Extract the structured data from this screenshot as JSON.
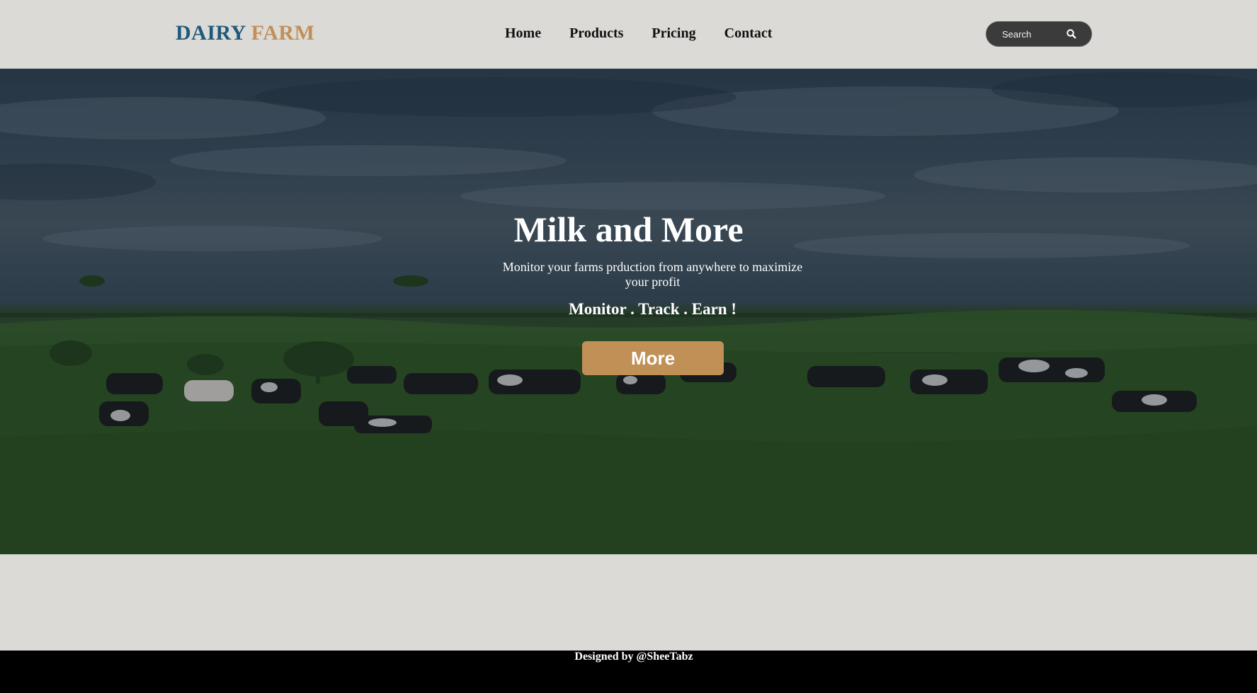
{
  "brand": {
    "word1": "DAIRY",
    "word2": "FARM"
  },
  "nav": {
    "items": [
      {
        "label": "Home"
      },
      {
        "label": "Products"
      },
      {
        "label": "Pricing"
      },
      {
        "label": "Contact"
      }
    ]
  },
  "search": {
    "placeholder": "Search",
    "icon": "search-icon"
  },
  "hero": {
    "title": "Milk and More",
    "subtitle": "Monitor your farms prduction from anywhere to maximize your profit",
    "tagline": "Monitor . Track . Earn !",
    "button_label": "More"
  },
  "footer": {
    "text": "Designed by @SheeTabz"
  },
  "colors": {
    "brand_blue": "#1f5a7a",
    "brand_gold": "#c09057",
    "page_bg": "#dbdad7",
    "footer_bg": "#000000"
  }
}
